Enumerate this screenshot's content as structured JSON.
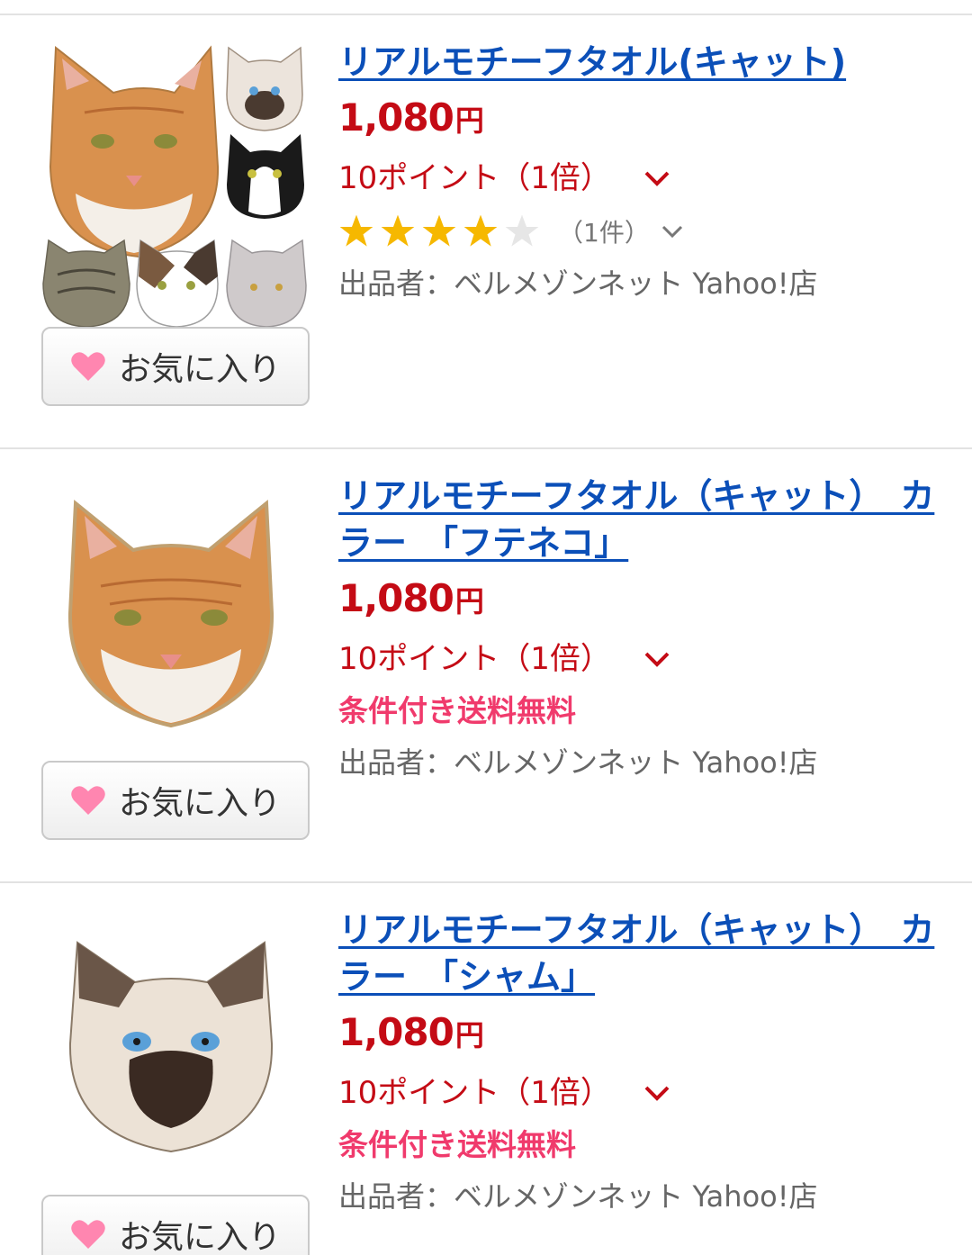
{
  "colors": {
    "title": "#0b4fb8",
    "price": "#c40b15",
    "shipping": "#f03a6c",
    "seller": "#666666",
    "star": "#f6b800",
    "heart": "#ff86b0"
  },
  "items": [
    {
      "title": "リアルモチーフタオル(キャット)",
      "price": "1,080",
      "currency": "円",
      "points": "10ポイント（1倍）",
      "rating_value": 4,
      "review_count": "（1件）",
      "seller": "出品者：ベルメゾンネット Yahoo!店",
      "favorite": "お気に入り"
    },
    {
      "title": "リアルモチーフタオル（キャット）　カラー　「フテネコ」",
      "price": "1,080",
      "currency": "円",
      "points": "10ポイント（1倍）",
      "shipping": "条件付き送料無料",
      "seller": "出品者：ベルメゾンネット Yahoo!店",
      "favorite": "お気に入り"
    },
    {
      "title": "リアルモチーフタオル（キャット）　カラー　「シャム」",
      "price": "1,080",
      "currency": "円",
      "points": "10ポイント（1倍）",
      "shipping": "条件付き送料無料",
      "seller": "出品者：ベルメゾンネット Yahoo!店",
      "favorite": "お気に入り"
    }
  ]
}
